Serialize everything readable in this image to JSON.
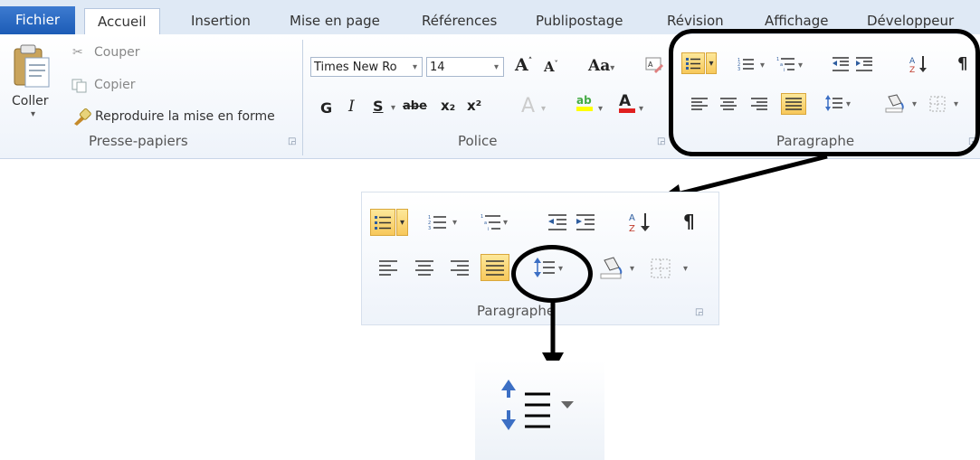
{
  "tabs": {
    "file": "Fichier",
    "items": [
      "Accueil",
      "Insertion",
      "Mise en page",
      "Références",
      "Publipostage",
      "Révision",
      "Affichage",
      "Développeur"
    ],
    "active": "Accueil"
  },
  "clipboard": {
    "paste": "Coller",
    "cut": "Couper",
    "copy": "Copier",
    "format_painter": "Reproduire la mise en forme",
    "group_label": "Presse-papiers"
  },
  "font": {
    "name": "Times New Ro",
    "size": "14",
    "grow": "A",
    "shrink": "A",
    "case": "Aa",
    "bold": "G",
    "italic": "I",
    "underline": "S",
    "strike": "abe",
    "subscript": "x₂",
    "superscript": "x²",
    "group_label": "Police"
  },
  "paragraph": {
    "group_label": "Paragraphe",
    "sort": "A Z",
    "pilcrow": "¶",
    "zoom_label": "Paragraphe"
  },
  "colors": {
    "highlight": "#f7c85b",
    "frame": "#000000",
    "tab_file": "#1c5cb6",
    "font_color_bar": "#e02020",
    "highlight_bar": "#ffff00"
  },
  "icons": [
    "paste-icon",
    "scissors-icon",
    "copy-icon",
    "format-painter-icon",
    "bullet-list-icon",
    "numbered-list-icon",
    "multilevel-list-icon",
    "decrease-indent-icon",
    "increase-indent-icon",
    "sort-icon",
    "pilcrow-icon",
    "align-left-icon",
    "align-center-icon",
    "align-right-icon",
    "justify-icon",
    "line-spacing-icon",
    "shading-icon",
    "borders-icon"
  ]
}
